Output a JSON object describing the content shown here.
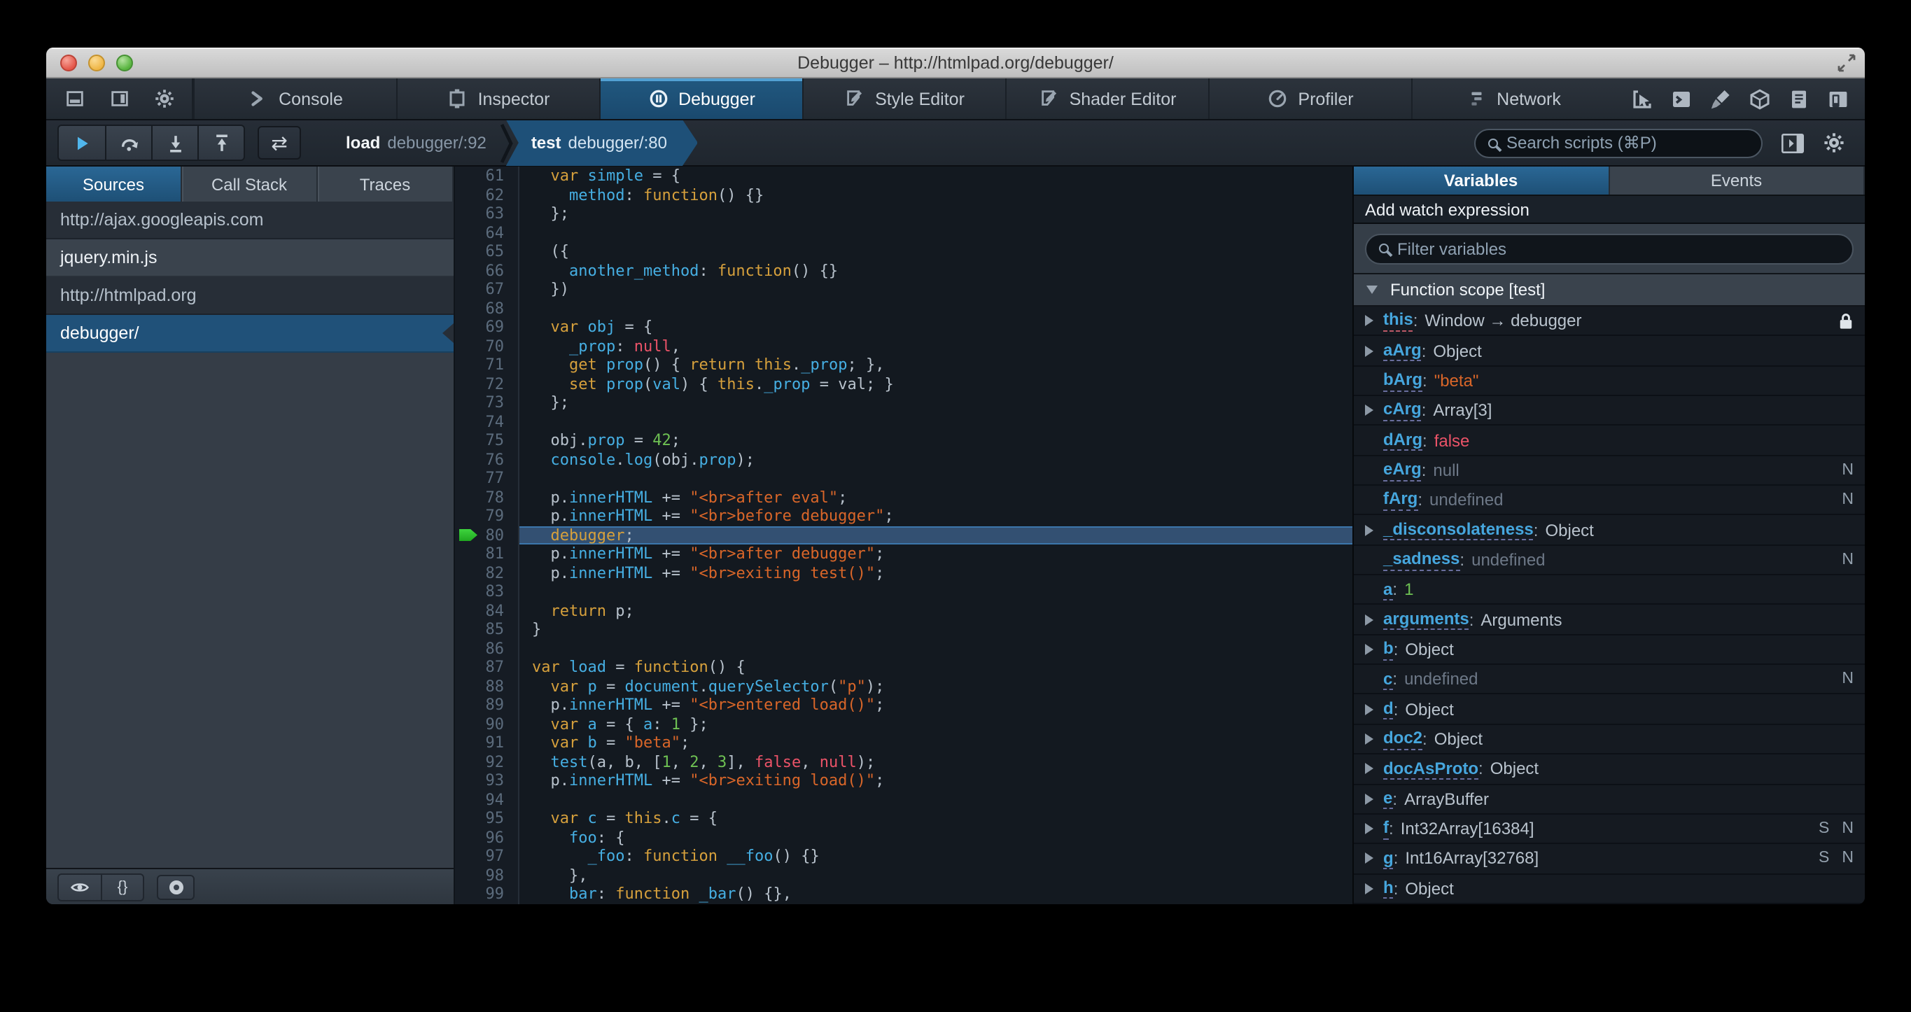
{
  "window": {
    "title": "Debugger – http://htmlpad.org/debugger/"
  },
  "colors": {
    "accent_blue": "#46afe3",
    "selection_blue": "#1e5078",
    "toolbar_bg": "#252c33",
    "editor_bg": "#131920",
    "sidebar_bg": "#353d47",
    "code_keyword": "#d6a03c",
    "code_identifier": "#46afe3",
    "code_string": "#d96629",
    "code_number": "#6ec153",
    "code_atom": "#eb5368",
    "current_line_bg": "#335072",
    "breakpoint_arrow_green": "#2fc32f"
  },
  "toolbox": {
    "left_icons": [
      "dock-bottom",
      "dock-side",
      "toolbox-options-gear"
    ],
    "tabs": [
      {
        "id": "console",
        "label": "Console"
      },
      {
        "id": "inspector",
        "label": "Inspector"
      },
      {
        "id": "debugger",
        "label": "Debugger"
      },
      {
        "id": "styleeditor",
        "label": "Style Editor"
      },
      {
        "id": "shadereditor",
        "label": "Shader Editor"
      },
      {
        "id": "profiler",
        "label": "Profiler"
      },
      {
        "id": "network",
        "label": "Network"
      }
    ],
    "active_tab": "debugger",
    "right_icons": [
      "pick-element",
      "split-console",
      "paintbrush",
      "tilt-3d",
      "scratchpad",
      "responsive-mode"
    ]
  },
  "dbg_toolbar": {
    "buttons": [
      "resume",
      "step-over",
      "step-in",
      "step-out"
    ],
    "trace_button": "⇄",
    "breadcrumbs": [
      {
        "fn": "load",
        "loc": "debugger/:92",
        "active": false
      },
      {
        "fn": "test",
        "loc": "debugger/:80",
        "active": true
      }
    ],
    "search_placeholder": "Search scripts (⌘P)"
  },
  "sources_panel": {
    "tabs": [
      "Sources",
      "Call Stack",
      "Traces"
    ],
    "active_tab": "Sources",
    "items": [
      {
        "label": "http://ajax.googleapis.com",
        "kind": "domain",
        "selected": false
      },
      {
        "label": "jquery.min.js",
        "kind": "file",
        "selected": false
      },
      {
        "label": "http://htmlpad.org",
        "kind": "domain",
        "selected": false
      },
      {
        "label": "debugger/",
        "kind": "file",
        "selected": true
      }
    ],
    "bottom_icons": [
      "eye-pretty-print",
      "braces-blackbox",
      "record-blackbox-circle"
    ],
    "braces_glyph": "{}"
  },
  "editor": {
    "first_line": 61,
    "current_line": 80,
    "lines": [
      {
        "n": 61,
        "t": [
          [
            "o",
            "  "
          ],
          [
            "k",
            "var"
          ],
          [
            "o",
            " "
          ],
          [
            "b",
            "simple"
          ],
          [
            "o",
            " = {"
          ]
        ]
      },
      {
        "n": 62,
        "t": [
          [
            "o",
            "    "
          ],
          [
            "b",
            "method"
          ],
          [
            "o",
            ": "
          ],
          [
            "k",
            "function"
          ],
          [
            "o",
            "() {}"
          ]
        ]
      },
      {
        "n": 63,
        "t": [
          [
            "o",
            "  };"
          ]
        ]
      },
      {
        "n": 64,
        "t": []
      },
      {
        "n": 65,
        "t": [
          [
            "o",
            "  ({"
          ]
        ]
      },
      {
        "n": 66,
        "t": [
          [
            "o",
            "    "
          ],
          [
            "b",
            "another_method"
          ],
          [
            "o",
            ": "
          ],
          [
            "k",
            "function"
          ],
          [
            "o",
            "() {}"
          ]
        ]
      },
      {
        "n": 67,
        "t": [
          [
            "o",
            "  })"
          ]
        ]
      },
      {
        "n": 68,
        "t": []
      },
      {
        "n": 69,
        "t": [
          [
            "o",
            "  "
          ],
          [
            "k",
            "var"
          ],
          [
            "o",
            " "
          ],
          [
            "b",
            "obj"
          ],
          [
            "o",
            " = {"
          ]
        ]
      },
      {
        "n": 70,
        "t": [
          [
            "o",
            "    "
          ],
          [
            "b",
            "_prop"
          ],
          [
            "o",
            ": "
          ],
          [
            "a",
            "null"
          ],
          [
            "o",
            ","
          ]
        ]
      },
      {
        "n": 71,
        "t": [
          [
            "o",
            "    "
          ],
          [
            "k",
            "get"
          ],
          [
            "o",
            " "
          ],
          [
            "b",
            "prop"
          ],
          [
            "o",
            "() { "
          ],
          [
            "k",
            "return"
          ],
          [
            "o",
            " "
          ],
          [
            "k",
            "this"
          ],
          [
            "o",
            "."
          ],
          [
            "b",
            "_prop"
          ],
          [
            "o",
            "; },"
          ]
        ]
      },
      {
        "n": 72,
        "t": [
          [
            "o",
            "    "
          ],
          [
            "k",
            "set"
          ],
          [
            "o",
            " "
          ],
          [
            "b",
            "prop"
          ],
          [
            "o",
            "("
          ],
          [
            "b",
            "val"
          ],
          [
            "o",
            ") { "
          ],
          [
            "k",
            "this"
          ],
          [
            "o",
            "."
          ],
          [
            "b",
            "_prop"
          ],
          [
            "o",
            " = val; }"
          ]
        ]
      },
      {
        "n": 73,
        "t": [
          [
            "o",
            "  };"
          ]
        ]
      },
      {
        "n": 74,
        "t": []
      },
      {
        "n": 75,
        "t": [
          [
            "o",
            "  obj."
          ],
          [
            "b",
            "prop"
          ],
          [
            "o",
            " = "
          ],
          [
            "n",
            "42"
          ],
          [
            "o",
            ";"
          ]
        ]
      },
      {
        "n": 76,
        "t": [
          [
            "o",
            "  "
          ],
          [
            "b",
            "console"
          ],
          [
            "o",
            "."
          ],
          [
            "b",
            "log"
          ],
          [
            "o",
            "(obj."
          ],
          [
            "b",
            "prop"
          ],
          [
            "o",
            ");"
          ]
        ]
      },
      {
        "n": 77,
        "t": []
      },
      {
        "n": 78,
        "t": [
          [
            "o",
            "  p."
          ],
          [
            "b",
            "innerHTML"
          ],
          [
            "o",
            " += "
          ],
          [
            "s",
            "\"<br>after eval\""
          ],
          [
            "o",
            ";"
          ]
        ]
      },
      {
        "n": 79,
        "t": [
          [
            "o",
            "  p."
          ],
          [
            "b",
            "innerHTML"
          ],
          [
            "o",
            " += "
          ],
          [
            "s",
            "\"<br>before debugger\""
          ],
          [
            "o",
            ";"
          ]
        ]
      },
      {
        "n": 80,
        "t": [
          [
            "o",
            "  "
          ],
          [
            "k",
            "debugger"
          ],
          [
            "o",
            ";"
          ]
        ]
      },
      {
        "n": 81,
        "t": [
          [
            "o",
            "  p."
          ],
          [
            "b",
            "innerHTML"
          ],
          [
            "o",
            " += "
          ],
          [
            "s",
            "\"<br>after debugger\""
          ],
          [
            "o",
            ";"
          ]
        ]
      },
      {
        "n": 82,
        "t": [
          [
            "o",
            "  p."
          ],
          [
            "b",
            "innerHTML"
          ],
          [
            "o",
            " += "
          ],
          [
            "s",
            "\"<br>exiting test()\""
          ],
          [
            "o",
            ";"
          ]
        ]
      },
      {
        "n": 83,
        "t": []
      },
      {
        "n": 84,
        "t": [
          [
            "o",
            "  "
          ],
          [
            "k",
            "return"
          ],
          [
            "o",
            " p;"
          ]
        ]
      },
      {
        "n": 85,
        "t": [
          [
            "o",
            "}"
          ]
        ]
      },
      {
        "n": 86,
        "t": []
      },
      {
        "n": 87,
        "t": [
          [
            "k",
            "var"
          ],
          [
            "o",
            " "
          ],
          [
            "b",
            "load"
          ],
          [
            "o",
            " = "
          ],
          [
            "k",
            "function"
          ],
          [
            "o",
            "() {"
          ]
        ]
      },
      {
        "n": 88,
        "t": [
          [
            "o",
            "  "
          ],
          [
            "k",
            "var"
          ],
          [
            "o",
            " "
          ],
          [
            "b",
            "p"
          ],
          [
            "o",
            " = "
          ],
          [
            "b",
            "document"
          ],
          [
            "o",
            "."
          ],
          [
            "b",
            "querySelector"
          ],
          [
            "o",
            "("
          ],
          [
            "s",
            "\"p\""
          ],
          [
            "o",
            ");"
          ]
        ]
      },
      {
        "n": 89,
        "t": [
          [
            "o",
            "  p."
          ],
          [
            "b",
            "innerHTML"
          ],
          [
            "o",
            " += "
          ],
          [
            "s",
            "\"<br>entered load()\""
          ],
          [
            "o",
            ";"
          ]
        ]
      },
      {
        "n": 90,
        "t": [
          [
            "o",
            "  "
          ],
          [
            "k",
            "var"
          ],
          [
            "o",
            " "
          ],
          [
            "b",
            "a"
          ],
          [
            "o",
            " = { "
          ],
          [
            "b",
            "a"
          ],
          [
            "o",
            ": "
          ],
          [
            "n",
            "1"
          ],
          [
            "o",
            " };"
          ]
        ]
      },
      {
        "n": 91,
        "t": [
          [
            "o",
            "  "
          ],
          [
            "k",
            "var"
          ],
          [
            "o",
            " "
          ],
          [
            "b",
            "b"
          ],
          [
            "o",
            " = "
          ],
          [
            "s",
            "\"beta\""
          ],
          [
            "o",
            ";"
          ]
        ]
      },
      {
        "n": 92,
        "t": [
          [
            "o",
            "  "
          ],
          [
            "b",
            "test"
          ],
          [
            "o",
            "(a, b, ["
          ],
          [
            "n",
            "1"
          ],
          [
            "o",
            ", "
          ],
          [
            "n",
            "2"
          ],
          [
            "o",
            ", "
          ],
          [
            "n",
            "3"
          ],
          [
            "o",
            "], "
          ],
          [
            "a",
            "false"
          ],
          [
            "o",
            ", "
          ],
          [
            "a",
            "null"
          ],
          [
            "o",
            ");"
          ]
        ]
      },
      {
        "n": 93,
        "t": [
          [
            "o",
            "  p."
          ],
          [
            "b",
            "innerHTML"
          ],
          [
            "o",
            " += "
          ],
          [
            "s",
            "\"<br>exiting load()\""
          ],
          [
            "o",
            ";"
          ]
        ]
      },
      {
        "n": 94,
        "t": []
      },
      {
        "n": 95,
        "t": [
          [
            "o",
            "  "
          ],
          [
            "k",
            "var"
          ],
          [
            "o",
            " "
          ],
          [
            "b",
            "c"
          ],
          [
            "o",
            " = "
          ],
          [
            "k",
            "this"
          ],
          [
            "o",
            "."
          ],
          [
            "b",
            "c"
          ],
          [
            "o",
            " = {"
          ]
        ]
      },
      {
        "n": 96,
        "t": [
          [
            "o",
            "    "
          ],
          [
            "b",
            "foo"
          ],
          [
            "o",
            ": {"
          ]
        ]
      },
      {
        "n": 97,
        "t": [
          [
            "o",
            "      "
          ],
          [
            "b",
            "_foo"
          ],
          [
            "o",
            ": "
          ],
          [
            "k",
            "function"
          ],
          [
            "o",
            " "
          ],
          [
            "b",
            "__foo"
          ],
          [
            "o",
            "() {}"
          ]
        ]
      },
      {
        "n": 98,
        "t": [
          [
            "o",
            "    },"
          ]
        ]
      },
      {
        "n": 99,
        "t": [
          [
            "o",
            "    "
          ],
          [
            "b",
            "bar"
          ],
          [
            "o",
            ": "
          ],
          [
            "k",
            "function"
          ],
          [
            "o",
            " "
          ],
          [
            "b",
            "_bar"
          ],
          [
            "o",
            "() {},"
          ]
        ]
      }
    ]
  },
  "variables_panel": {
    "tabs": [
      "Variables",
      "Events"
    ],
    "active_tab": "Variables",
    "add_watch_label": "Add watch expression",
    "filter_placeholder": "Filter variables",
    "scope_label": "Function scope [test]",
    "vars": [
      {
        "name": "this",
        "value": "Window → debugger",
        "vclass": "obj",
        "expand": true,
        "lock": true,
        "pink": true,
        "badges": []
      },
      {
        "name": "aArg",
        "value": "Object",
        "vclass": "obj",
        "expand": true,
        "lock": false,
        "pink": false,
        "badges": []
      },
      {
        "name": "bArg",
        "value": "\"beta\"",
        "vclass": "str",
        "expand": false,
        "lock": false,
        "pink": false,
        "badges": []
      },
      {
        "name": "cArg",
        "value": "Array[3]",
        "vclass": "obj",
        "expand": true,
        "lock": false,
        "pink": false,
        "badges": []
      },
      {
        "name": "dArg",
        "value": "false",
        "vclass": "atom",
        "expand": false,
        "lock": false,
        "pink": false,
        "badges": []
      },
      {
        "name": "eArg",
        "value": "null",
        "vclass": "muted",
        "expand": false,
        "lock": false,
        "pink": false,
        "badges": [
          "N"
        ]
      },
      {
        "name": "fArg",
        "value": "undefined",
        "vclass": "muted",
        "expand": false,
        "lock": false,
        "pink": false,
        "badges": [
          "N"
        ]
      },
      {
        "name": "_disconsolateness",
        "value": "Object",
        "vclass": "obj",
        "expand": true,
        "lock": false,
        "pink": false,
        "badges": []
      },
      {
        "name": "_sadness",
        "value": "undefined",
        "vclass": "muted",
        "expand": false,
        "lock": false,
        "pink": false,
        "badges": [
          "N"
        ]
      },
      {
        "name": "a",
        "value": "1",
        "vclass": "num",
        "expand": false,
        "lock": false,
        "pink": false,
        "badges": []
      },
      {
        "name": "arguments",
        "value": "Arguments",
        "vclass": "obj",
        "expand": true,
        "lock": false,
        "pink": false,
        "badges": []
      },
      {
        "name": "b",
        "value": "Object",
        "vclass": "obj",
        "expand": true,
        "lock": false,
        "pink": false,
        "badges": []
      },
      {
        "name": "c",
        "value": "undefined",
        "vclass": "muted",
        "expand": false,
        "lock": false,
        "pink": false,
        "badges": [
          "N"
        ]
      },
      {
        "name": "d",
        "value": "Object",
        "vclass": "obj",
        "expand": true,
        "lock": false,
        "pink": false,
        "badges": []
      },
      {
        "name": "doc2",
        "value": "Object",
        "vclass": "obj",
        "expand": true,
        "lock": false,
        "pink": false,
        "badges": []
      },
      {
        "name": "docAsProto",
        "value": "Object",
        "vclass": "obj",
        "expand": true,
        "lock": false,
        "pink": false,
        "badges": []
      },
      {
        "name": "e",
        "value": "ArrayBuffer",
        "vclass": "obj",
        "expand": true,
        "lock": false,
        "pink": false,
        "badges": []
      },
      {
        "name": "f",
        "value": "Int32Array[16384]",
        "vclass": "obj",
        "expand": true,
        "lock": false,
        "pink": false,
        "badges": [
          "S",
          "N"
        ]
      },
      {
        "name": "g",
        "value": "Int16Array[32768]",
        "vclass": "obj",
        "expand": true,
        "lock": false,
        "pink": false,
        "badges": [
          "S",
          "N"
        ]
      },
      {
        "name": "h",
        "value": "Object",
        "vclass": "obj",
        "expand": true,
        "lock": false,
        "pink": false,
        "badges": []
      }
    ]
  }
}
